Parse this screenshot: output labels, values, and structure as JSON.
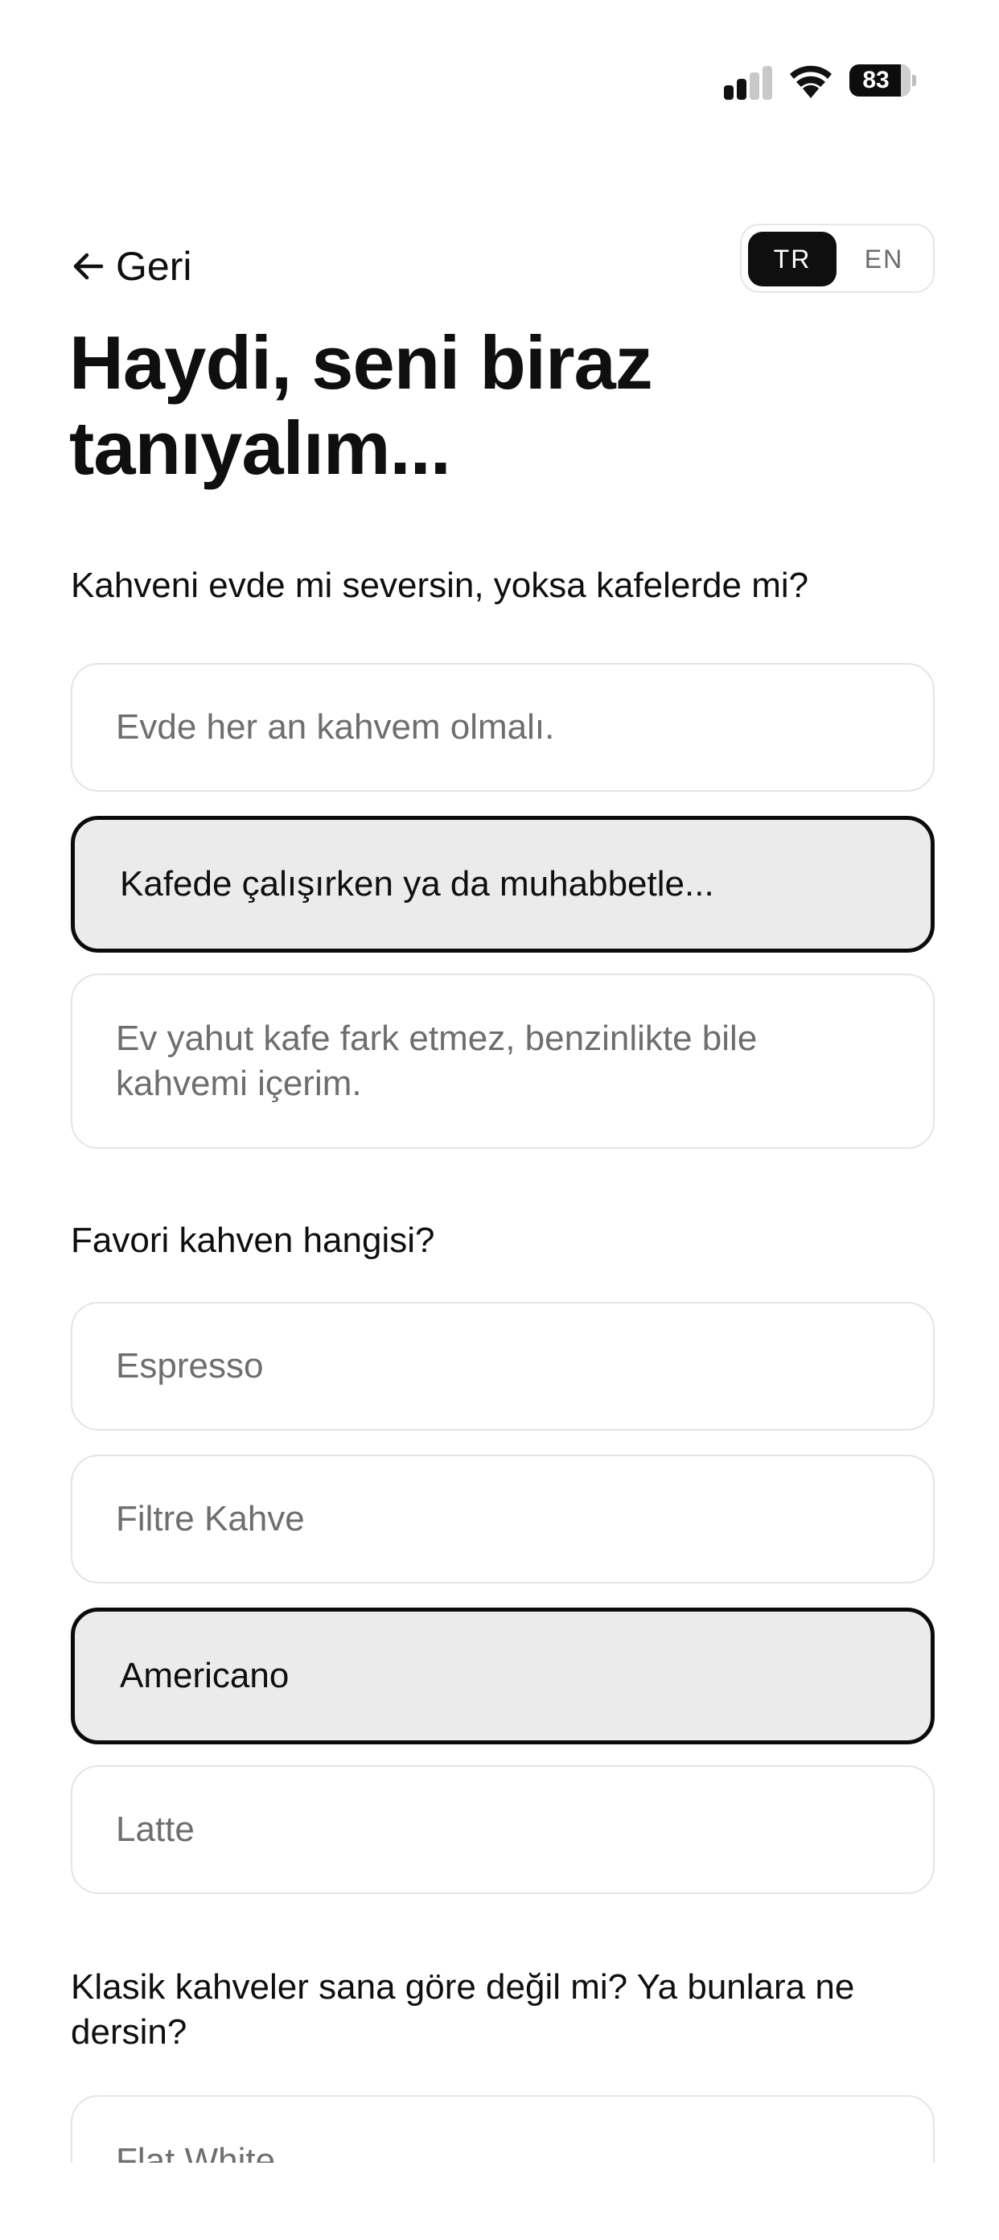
{
  "status_bar": {
    "battery": "83",
    "icons": [
      "signal-icon",
      "wifi-icon",
      "battery-icon"
    ]
  },
  "header": {
    "back_label": "Geri",
    "back_icon": "arrow-left-icon",
    "language": {
      "options": [
        "TR",
        "EN"
      ],
      "selected": "TR"
    }
  },
  "title": "Haydi, seni biraz tanıyalım...",
  "questions": [
    {
      "text": "Kahveni evde mi seversin, yoksa kafelerde mi?",
      "options": [
        "Evde her an kahvem olmalı.",
        "Kafede çalışırken ya da muhabbetle...",
        "Ev yahut kafe fark etmez, benzinlikte bile kahvemi içerim."
      ],
      "selected": "Kafede çalışırken ya da muhabbetle..."
    },
    {
      "text": "Favori kahven hangisi?",
      "options": [
        "Espresso",
        "Filtre Kahve",
        "Americano",
        "Latte"
      ],
      "selected": "Americano"
    },
    {
      "text": "Klasik kahveler sana göre değil mi? Ya bunlara ne dersin?",
      "options": [
        "Flat White"
      ]
    }
  ],
  "colors": {
    "selected_border": "#0b0b0b",
    "selected_fill": "#ebebeb",
    "option_border": "#e4e4e4",
    "placeholder_text": "#6e6e6e"
  }
}
